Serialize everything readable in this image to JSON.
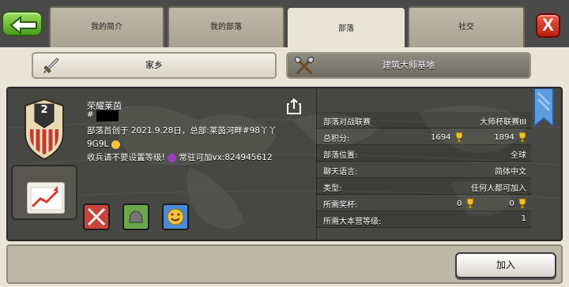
{
  "tabs": {
    "profile": "我的简介",
    "my_clan": "我的部落",
    "clans": "部落",
    "social": "社交"
  },
  "close_label": "X",
  "subtabs": {
    "home": "家乡",
    "builder": "建筑大师基地"
  },
  "clan": {
    "name": "荣耀莱茵",
    "tag": "#",
    "level": "2",
    "description_line1": "部落首创于 2021.9.28日，总部:莱茵河畔#98丫丫",
    "description_line2": "9G9L",
    "description_line3a": "收兵请不要设置等级!",
    "description_line3b": "常驻可加vx:824945612"
  },
  "stats": [
    {
      "label": "部落对战联赛",
      "value": "大师杯联赛III"
    },
    {
      "label": "总积分:",
      "value_a": "1694",
      "value_b": "1894"
    },
    {
      "label": "部落位置:",
      "value": "全球"
    },
    {
      "label": "聊天语言:",
      "value": "简体中文"
    },
    {
      "label": "类型:",
      "value": "任何人都可加入"
    },
    {
      "label": "所需奖杯:",
      "value_a": "0",
      "value_b": "0"
    },
    {
      "label": "所需大本营等级:",
      "value": "1"
    }
  ],
  "join_label": "加入",
  "colors": {
    "tab_active": "#e8e4d6",
    "panel": "#3e3e3e",
    "back_green": "#4c9a1e",
    "close_red": "#b81e12",
    "ribbon_blue": "#5b9be0"
  },
  "icons": [
    "back-arrow-icon",
    "close-icon",
    "sword-icon",
    "crossed-axes-icon",
    "clan-badge-icon",
    "share-icon",
    "progress-graph-icon",
    "trophy-icon",
    "ribbon-icon",
    "label-icons"
  ]
}
